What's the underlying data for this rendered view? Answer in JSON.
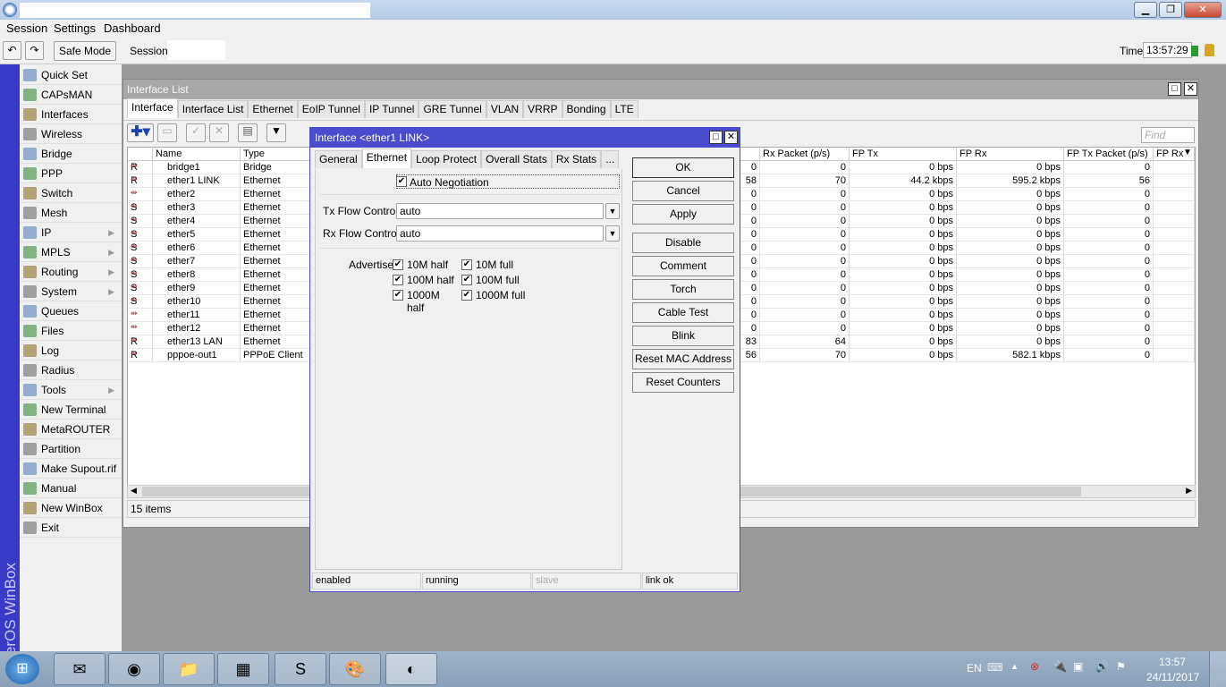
{
  "menu": [
    "Session",
    "Settings",
    "Dashboard"
  ],
  "toolbar": {
    "safe_mode": "Safe Mode",
    "session_label": "Session:",
    "time_label": "Time:",
    "time": "13:57:29"
  },
  "brand": "RouterOS WinBox",
  "sidebar": [
    {
      "label": "Quick Set",
      "icon": "wand-icon",
      "sub": false
    },
    {
      "label": "CAPsMAN",
      "icon": "antenna-icon",
      "sub": false
    },
    {
      "label": "Interfaces",
      "icon": "nic-icon",
      "sub": false
    },
    {
      "label": "Wireless",
      "icon": "antenna-icon",
      "sub": false
    },
    {
      "label": "Bridge",
      "icon": "bridge-icon",
      "sub": false
    },
    {
      "label": "PPP",
      "icon": "ppp-icon",
      "sub": false
    },
    {
      "label": "Switch",
      "icon": "switch-icon",
      "sub": false
    },
    {
      "label": "Mesh",
      "icon": "mesh-icon",
      "sub": false
    },
    {
      "label": "IP",
      "icon": "ip-icon",
      "sub": true
    },
    {
      "label": "MPLS",
      "icon": "mpls-icon",
      "sub": true
    },
    {
      "label": "Routing",
      "icon": "routing-icon",
      "sub": true
    },
    {
      "label": "System",
      "icon": "gear-icon",
      "sub": true
    },
    {
      "label": "Queues",
      "icon": "queues-icon",
      "sub": false
    },
    {
      "label": "Files",
      "icon": "folder-icon",
      "sub": false
    },
    {
      "label": "Log",
      "icon": "log-icon",
      "sub": false
    },
    {
      "label": "Radius",
      "icon": "radius-icon",
      "sub": false
    },
    {
      "label": "Tools",
      "icon": "tools-icon",
      "sub": true
    },
    {
      "label": "New Terminal",
      "icon": "terminal-icon",
      "sub": false
    },
    {
      "label": "MetaROUTER",
      "icon": "metarouter-icon",
      "sub": false
    },
    {
      "label": "Partition",
      "icon": "pie-icon",
      "sub": false
    },
    {
      "label": "Make Supout.rif",
      "icon": "file-icon",
      "sub": false
    },
    {
      "label": "Manual",
      "icon": "manual-icon",
      "sub": false
    },
    {
      "label": "New WinBox",
      "icon": "winbox-icon",
      "sub": false
    },
    {
      "label": "Exit",
      "icon": "exit-icon",
      "sub": false
    }
  ],
  "interface_list": {
    "title": "Interface List",
    "tabs": [
      "Interface",
      "Interface List",
      "Ethernet",
      "EoIP Tunnel",
      "IP Tunnel",
      "GRE Tunnel",
      "VLAN",
      "VRRP",
      "Bonding",
      "LTE"
    ],
    "find_placeholder": "Find",
    "columns_left": [
      "",
      "Name",
      "Type"
    ],
    "columns_right": [
      "",
      "Rx Packet (p/s)",
      "FP Tx",
      "FP Rx",
      "FP Tx Packet (p/s)",
      "FP Rx"
    ],
    "rows": [
      {
        "flag": "R",
        "name": "bridge1",
        "type": "Bridge",
        "tx_pkt": "0",
        "rx_pkt": "0",
        "fp_tx": "0 bps",
        "fp_rx": "0 bps",
        "fp_tx_pkt": "0"
      },
      {
        "flag": "R",
        "name": "ether1 LINK",
        "type": "Ethernet",
        "tx_pkt": "58",
        "rx_pkt": "70",
        "fp_tx": "44.2 kbps",
        "fp_rx": "595.2 kbps",
        "fp_tx_pkt": "56"
      },
      {
        "flag": "",
        "name": "ether2",
        "type": "Ethernet",
        "tx_pkt": "0",
        "rx_pkt": "0",
        "fp_tx": "0 bps",
        "fp_rx": "0 bps",
        "fp_tx_pkt": "0"
      },
      {
        "flag": "S",
        "name": "ether3",
        "type": "Ethernet",
        "tx_pkt": "0",
        "rx_pkt": "0",
        "fp_tx": "0 bps",
        "fp_rx": "0 bps",
        "fp_tx_pkt": "0"
      },
      {
        "flag": "S",
        "name": "ether4",
        "type": "Ethernet",
        "tx_pkt": "0",
        "rx_pkt": "0",
        "fp_tx": "0 bps",
        "fp_rx": "0 bps",
        "fp_tx_pkt": "0"
      },
      {
        "flag": "S",
        "name": "ether5",
        "type": "Ethernet",
        "tx_pkt": "0",
        "rx_pkt": "0",
        "fp_tx": "0 bps",
        "fp_rx": "0 bps",
        "fp_tx_pkt": "0"
      },
      {
        "flag": "S",
        "name": "ether6",
        "type": "Ethernet",
        "tx_pkt": "0",
        "rx_pkt": "0",
        "fp_tx": "0 bps",
        "fp_rx": "0 bps",
        "fp_tx_pkt": "0"
      },
      {
        "flag": "S",
        "name": "ether7",
        "type": "Ethernet",
        "tx_pkt": "0",
        "rx_pkt": "0",
        "fp_tx": "0 bps",
        "fp_rx": "0 bps",
        "fp_tx_pkt": "0"
      },
      {
        "flag": "S",
        "name": "ether8",
        "type": "Ethernet",
        "tx_pkt": "0",
        "rx_pkt": "0",
        "fp_tx": "0 bps",
        "fp_rx": "0 bps",
        "fp_tx_pkt": "0"
      },
      {
        "flag": "S",
        "name": "ether9",
        "type": "Ethernet",
        "tx_pkt": "0",
        "rx_pkt": "0",
        "fp_tx": "0 bps",
        "fp_rx": "0 bps",
        "fp_tx_pkt": "0"
      },
      {
        "flag": "S",
        "name": "ether10",
        "type": "Ethernet",
        "tx_pkt": "0",
        "rx_pkt": "0",
        "fp_tx": "0 bps",
        "fp_rx": "0 bps",
        "fp_tx_pkt": "0"
      },
      {
        "flag": "",
        "name": "ether11",
        "type": "Ethernet",
        "tx_pkt": "0",
        "rx_pkt": "0",
        "fp_tx": "0 bps",
        "fp_rx": "0 bps",
        "fp_tx_pkt": "0"
      },
      {
        "flag": "",
        "name": "ether12",
        "type": "Ethernet",
        "tx_pkt": "0",
        "rx_pkt": "0",
        "fp_tx": "0 bps",
        "fp_rx": "0 bps",
        "fp_tx_pkt": "0"
      },
      {
        "flag": "R",
        "name": "ether13 LAN",
        "type": "Ethernet",
        "tx_pkt": "83",
        "rx_pkt": "64",
        "fp_tx": "0 bps",
        "fp_rx": "0 bps",
        "fp_tx_pkt": "0"
      },
      {
        "flag": "R",
        "name": "pppoe-out1",
        "type": "PPPoE Client",
        "tx_pkt": "56",
        "rx_pkt": "70",
        "fp_tx": "0 bps",
        "fp_rx": "582.1 kbps",
        "fp_tx_pkt": "0"
      }
    ],
    "item_count": "15 items"
  },
  "dialog": {
    "title": "Interface <ether1 LINK>",
    "tabs": [
      "General",
      "Ethernet",
      "Loop Protect",
      "Overall Stats",
      "Rx Stats",
      "..."
    ],
    "auto_negotiation": "Auto Negotiation",
    "tx_flow_label": "Tx Flow Control:",
    "tx_flow_value": "auto",
    "rx_flow_label": "Rx Flow Control:",
    "rx_flow_value": "auto",
    "advertise_label": "Advertise:",
    "advertise": [
      "10M half",
      "10M full",
      "100M half",
      "100M full",
      "1000M half",
      "1000M full"
    ],
    "buttons": [
      "OK",
      "Cancel",
      "Apply",
      "Disable",
      "Comment",
      "Torch",
      "Cable Test",
      "Blink",
      "Reset MAC Address",
      "Reset Counters"
    ],
    "status": [
      "enabled",
      "running",
      "slave",
      "link ok"
    ]
  },
  "tray": {
    "lang": "EN",
    "time": "13:57",
    "date": "24/11/2017"
  }
}
